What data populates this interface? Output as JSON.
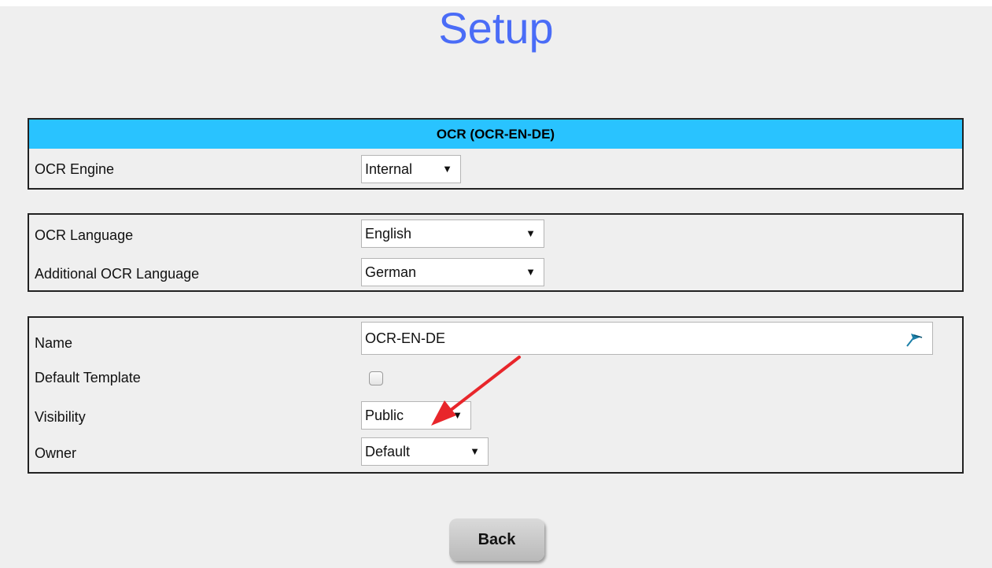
{
  "page": {
    "title": "Setup"
  },
  "ocr_section": {
    "header": "OCR (OCR-EN-DE)",
    "engine_label": "OCR Engine",
    "engine_value": "Internal"
  },
  "language_section": {
    "language_label": "OCR Language",
    "language_value": "English",
    "additional_language_label": "Additional OCR Language",
    "additional_language_value": "German"
  },
  "template_section": {
    "name_label": "Name",
    "name_value": "OCR-EN-DE",
    "default_template_label": "Default Template",
    "default_template_checked": false,
    "visibility_label": "Visibility",
    "visibility_value": "Public",
    "owner_label": "Owner",
    "owner_value": "Default"
  },
  "actions": {
    "back_label": "Back"
  },
  "icons": {
    "dropdown_arrow": "▼",
    "name_field_icon": "pin-icon",
    "annotation": "red-arrow-annotation"
  },
  "colors": {
    "title": "#4a6cf7",
    "section_header": "#29c3ff",
    "annotation_arrow": "#e8262b"
  }
}
